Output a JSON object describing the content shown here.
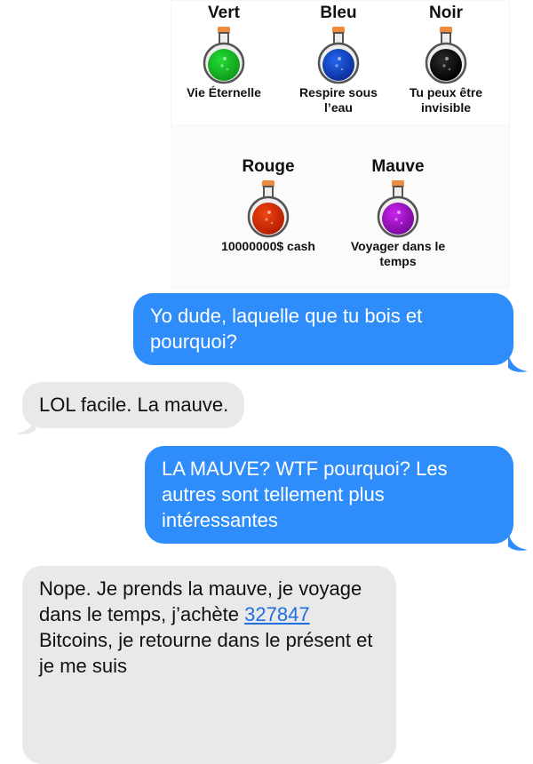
{
  "potions": [
    {
      "id": "vert",
      "name": "Vert",
      "desc": "Vie Éternelle",
      "liquid": "#22dd33",
      "dark": "#129a1c"
    },
    {
      "id": "bleu",
      "name": "Bleu",
      "desc": "Respire sous l’eau",
      "liquid": "#2266ee",
      "dark": "#0b2f9c"
    },
    {
      "id": "noir",
      "name": "Noir",
      "desc": "Tu peux être invisible",
      "liquid": "#2b2b2b",
      "dark": "#000000"
    },
    {
      "id": "rouge",
      "name": "Rouge",
      "desc": "10000000$ cash",
      "liquid": "#ee4411",
      "dark": "#b81e00"
    },
    {
      "id": "mauve",
      "name": "Mauve",
      "desc": "Voyager dans le temps",
      "liquid": "#cc22ee",
      "dark": "#7a0a9e"
    }
  ],
  "messages": [
    {
      "id": "msg1",
      "side": "out",
      "text": "Yo dude, laquelle que tu bois et pourquoi?"
    },
    {
      "id": "msg2",
      "side": "in",
      "text": "LOL facile. La mauve."
    },
    {
      "id": "msg3",
      "side": "out",
      "text": "LA MAUVE? WTF pourquoi? Les autres sont tellement plus intéressantes"
    },
    {
      "id": "msg4",
      "side": "in",
      "text_before": "Nope. Je prends la mauve, je voyage dans le temps, j’achète ",
      "link": "327847",
      "text_after": " Bitcoins, je retourne dans le présent et je me suis"
    }
  ],
  "colors": {
    "outgoing": "#2f8dfb",
    "incoming": "#e9e9eb",
    "link": "#1f6fe0",
    "cork": "#f08a3c"
  }
}
